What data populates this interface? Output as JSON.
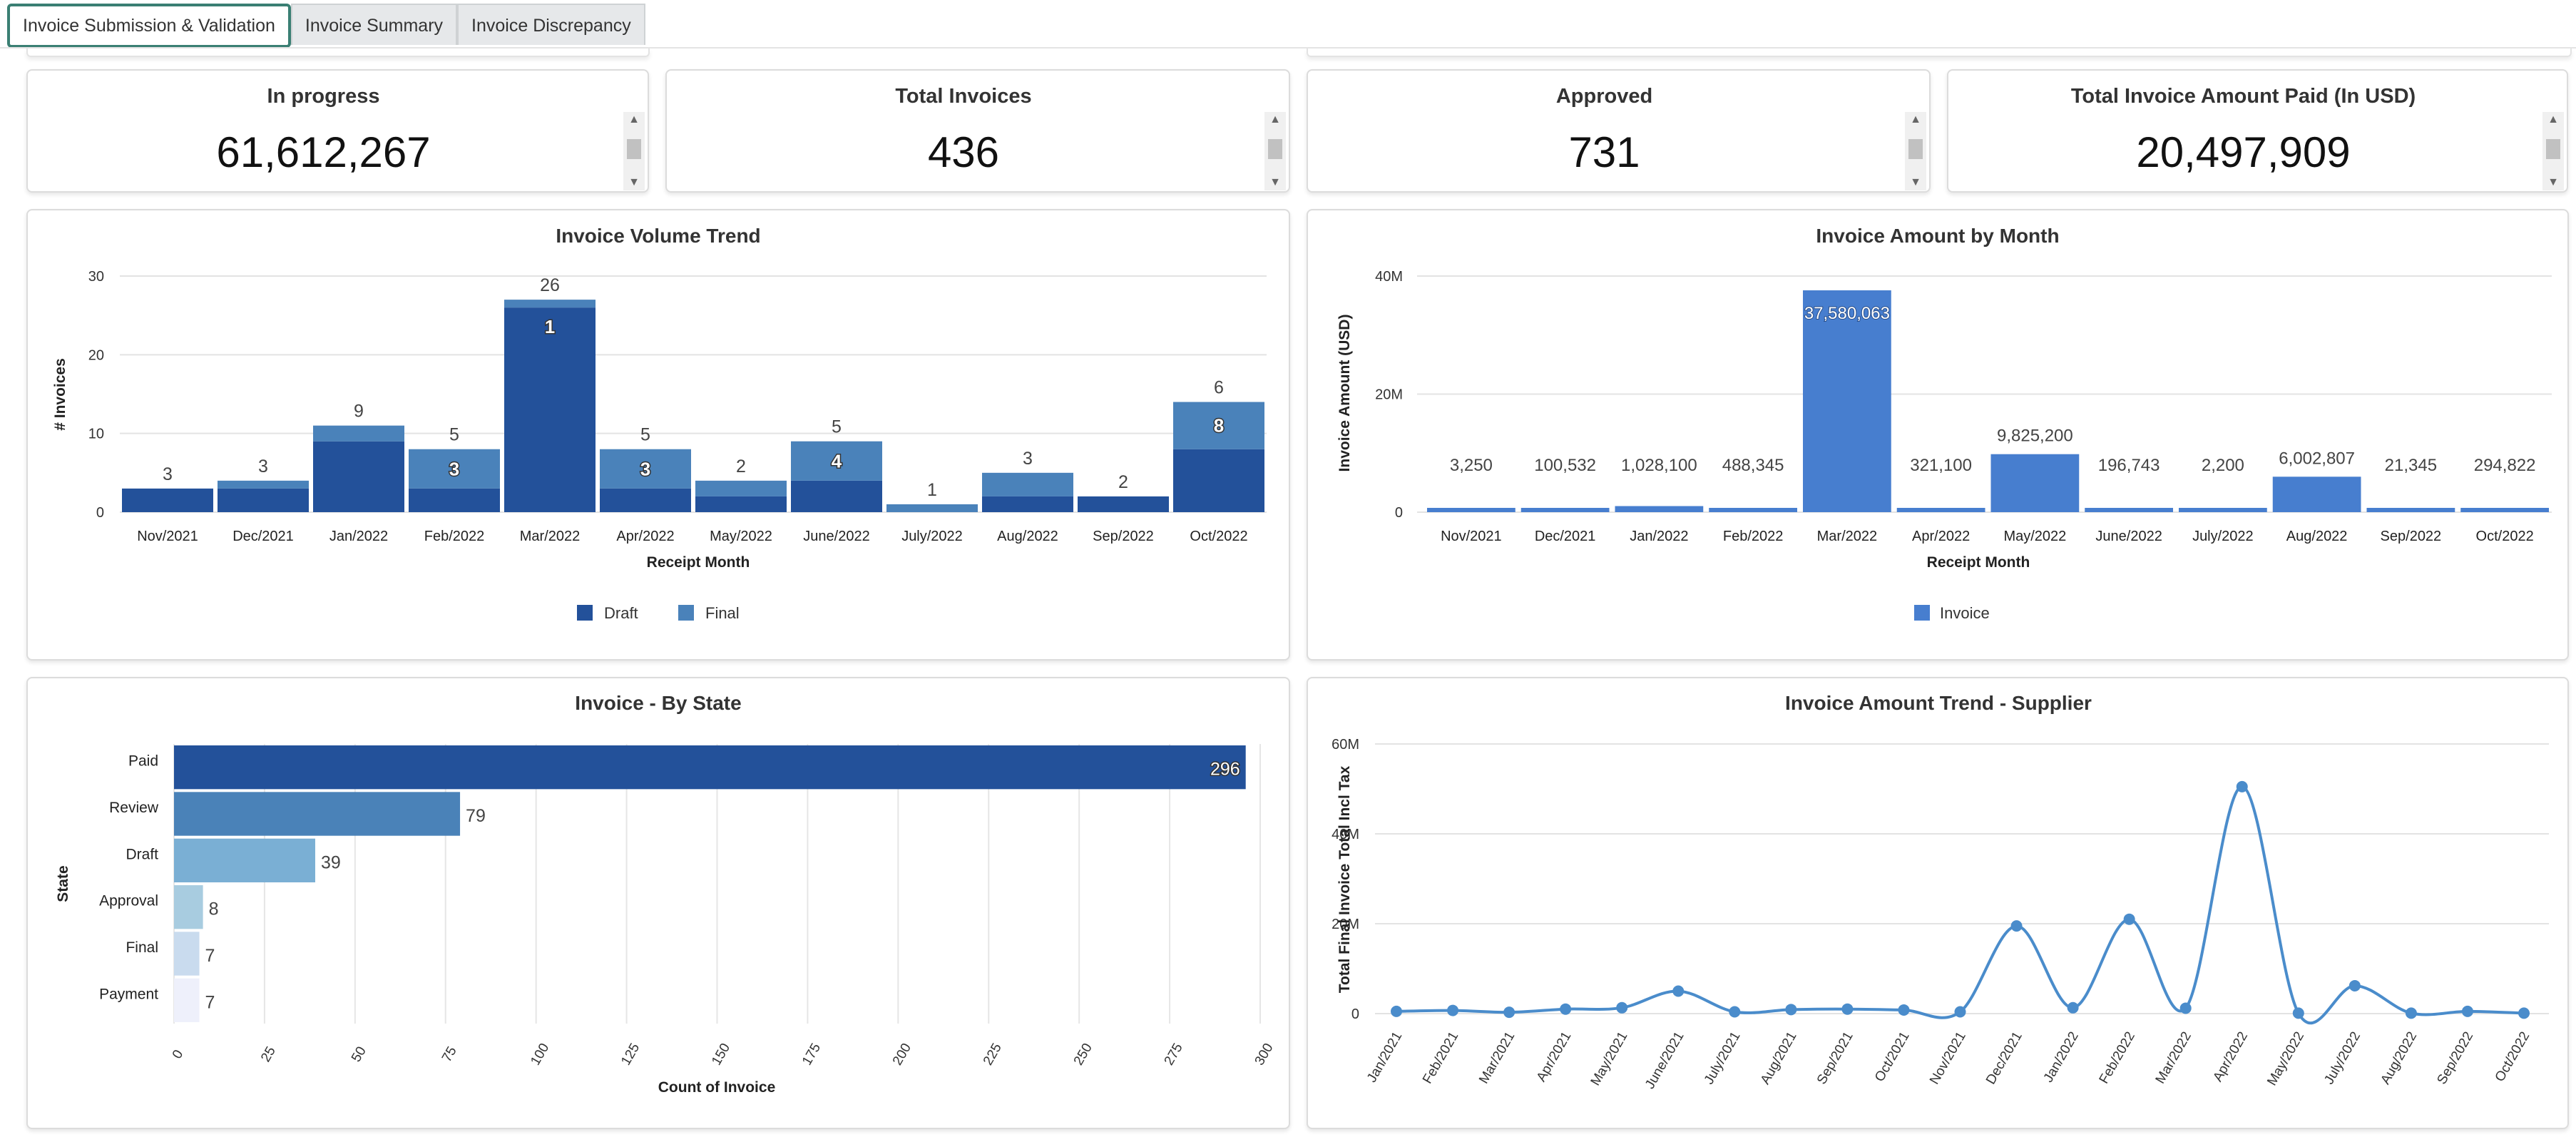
{
  "tabs": [
    {
      "label": "Invoice Submission & Validation",
      "active": true
    },
    {
      "label": "Invoice Summary",
      "active": false
    },
    {
      "label": "Invoice Discrepancy",
      "active": false
    }
  ],
  "kpis": [
    {
      "title": "In progress",
      "value": "61,612,267"
    },
    {
      "title": "Total Invoices",
      "value": "436"
    },
    {
      "title": "Approved",
      "value": "731"
    },
    {
      "title": "Total Invoice Amount Paid (In USD)",
      "value": "20,497,909"
    }
  ],
  "scrollbar": {
    "up": "▲",
    "down": "▼"
  },
  "chart_data": [
    {
      "type": "bar",
      "stacked": true,
      "title": "Invoice Volume Trend",
      "xlabel": "Receipt Month",
      "ylabel": "# Invoices",
      "ylim": [
        0,
        30
      ],
      "yticks": [
        "0",
        "10",
        "20",
        "30"
      ],
      "grid": true,
      "legend": "bottom",
      "categories": [
        "Nov/2021",
        "Dec/2021",
        "Jan/2022",
        "Feb/2022",
        "Mar/2022",
        "Apr/2022",
        "May/2022",
        "June/2022",
        "July/2022",
        "Aug/2022",
        "Sep/2022",
        "Oct/2022"
      ],
      "series": [
        {
          "name": "Draft",
          "color": "#23519a",
          "values": [
            3,
            3,
            9,
            3,
            26,
            3,
            2,
            4,
            0,
            2,
            2,
            8
          ]
        },
        {
          "name": "Final",
          "color": "#4a82ba",
          "values": [
            0,
            1,
            2,
            5,
            1,
            5,
            2,
            5,
            1,
            3,
            0,
            6
          ]
        }
      ],
      "top_labels": [
        "3",
        "3",
        "9",
        "5",
        "26",
        "5",
        "2",
        "5",
        "1",
        "3",
        "2",
        "6"
      ],
      "inner_labels": [
        "",
        "",
        "",
        "3",
        "1",
        "3",
        "",
        "4",
        "",
        "",
        "",
        "8"
      ]
    },
    {
      "type": "bar",
      "title": "Invoice Amount by Month",
      "xlabel": "Receipt Month",
      "ylabel": "Invoice Amount (USD)",
      "ylim": [
        0,
        40000000
      ],
      "yticks": [
        "0",
        "20M",
        "40M"
      ],
      "grid": true,
      "legend": "bottom",
      "categories": [
        "Nov/2021",
        "Dec/2021",
        "Jan/2022",
        "Feb/2022",
        "Mar/2022",
        "Apr/2022",
        "May/2022",
        "June/2022",
        "July/2022",
        "Aug/2022",
        "Sep/2022",
        "Oct/2022"
      ],
      "series": [
        {
          "name": "Invoice",
          "color": "#477ecf",
          "values": [
            3250,
            100532,
            1028100,
            488345,
            37580063,
            321100,
            9825200,
            196743,
            2200,
            6002807,
            21345,
            294822
          ]
        }
      ],
      "labels": [
        "3,250",
        "100,532",
        "1,028,100",
        "488,345",
        "37,580,063",
        "321,100",
        "9,825,200",
        "196,743",
        "2,200",
        "6,002,807",
        "21,345",
        "294,822"
      ]
    },
    {
      "type": "bar",
      "orientation": "horizontal",
      "title": "Invoice - By State",
      "xlabel": "Count of Invoice",
      "ylabel": "State",
      "xlim": [
        0,
        300
      ],
      "xticks": [
        "0",
        "25",
        "50",
        "75",
        "100",
        "125",
        "150",
        "175",
        "200",
        "225",
        "250",
        "275",
        "300"
      ],
      "grid": true,
      "categories": [
        "Paid",
        "Review",
        "Draft",
        "Approval",
        "Final",
        "Payment"
      ],
      "values": [
        296,
        79,
        39,
        8,
        7,
        7
      ],
      "colors": [
        "#23519a",
        "#4a82b8",
        "#7aafd4",
        "#a8cce0",
        "#c9dbee",
        "#eef0fb"
      ]
    },
    {
      "type": "line",
      "smooth": true,
      "title": "Invoice Amount Trend - Supplier",
      "xlabel": "",
      "ylabel": "Total Final Invoice Total Incl Tax",
      "ylim": [
        0,
        60000000
      ],
      "yticks": [
        "0",
        "20M",
        "40M",
        "60M"
      ],
      "grid": true,
      "color": "#4a8ccb",
      "x": [
        "Jan/2021",
        "Feb/2021",
        "Mar/2021",
        "Apr/2021",
        "May/2021",
        "June/2021",
        "July/2021",
        "Aug/2021",
        "Sep/2021",
        "Oct/2021",
        "Nov/2021",
        "Dec/2021",
        "Jan/2022",
        "Feb/2022",
        "Mar/2022",
        "Apr/2022",
        "May/2022",
        "July/2022",
        "Aug/2022",
        "Sep/2022",
        "Oct/2022"
      ],
      "values": [
        500000,
        700000,
        300000,
        1000000,
        1300000,
        5000000,
        400000,
        900000,
        1000000,
        800000,
        400000,
        19500000,
        1300000,
        21000000,
        1200000,
        50500000,
        100000,
        6200000,
        100000,
        500000,
        100000
      ]
    }
  ]
}
